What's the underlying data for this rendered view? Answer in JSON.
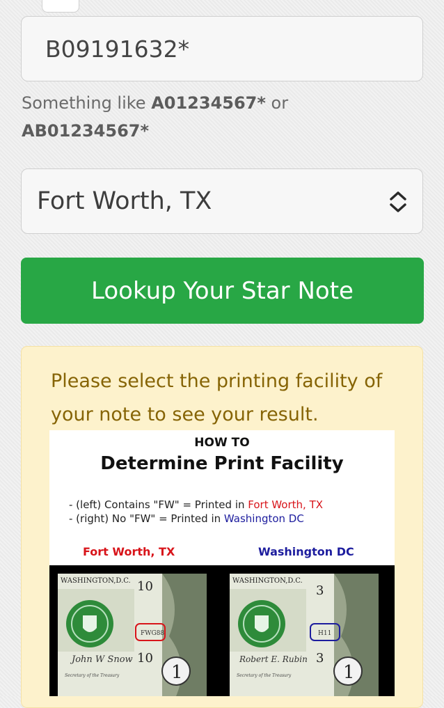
{
  "form": {
    "serial_value": "B09191632*",
    "hint_prefix": "Something like ",
    "hint_example1": "A01234567*",
    "hint_mid": " or",
    "hint_example2": "AB01234567*",
    "facility_selected": "Fort Worth, TX",
    "lookup_label": "Lookup Your Star Note"
  },
  "alert": {
    "message": "Please select the printing facility of your note to see your result."
  },
  "guide": {
    "howto": "HOW TO",
    "title": "Determine Print Facility",
    "line1_prefix": "- (left) Contains \"FW\" = Printed in ",
    "line1_place": "Fort Worth, TX",
    "line2_prefix": "- (right) No \"FW\" = Printed in ",
    "line2_place": "Washington DC",
    "caption_left": "Fort Worth, TX",
    "caption_right": "Washington DC",
    "bill_left": {
      "header": "WASHINGTON,D.C.",
      "plate_top": "10",
      "plate_bottom": "10",
      "fw_mark": "FWG88",
      "treasurer": "Secretary of the Treasury",
      "signature": "John W Snow"
    },
    "bill_right": {
      "header": "WASHINGTON,D.C.",
      "plate_top": "3",
      "plate_bottom": "3",
      "dc_mark": "H11",
      "treasurer": "Secretary of the Treasury",
      "signature": "Robert E. Rubin"
    },
    "colors": {
      "fort_worth": "#d8141a",
      "washington": "#1d1d9e",
      "seal_green": "#2e8b3a"
    }
  },
  "icons": {
    "select_chevron": "chevron-up-down-icon"
  },
  "colors": {
    "button": "#28a745",
    "alert_bg": "#fdf2cc",
    "alert_text": "#866405"
  }
}
